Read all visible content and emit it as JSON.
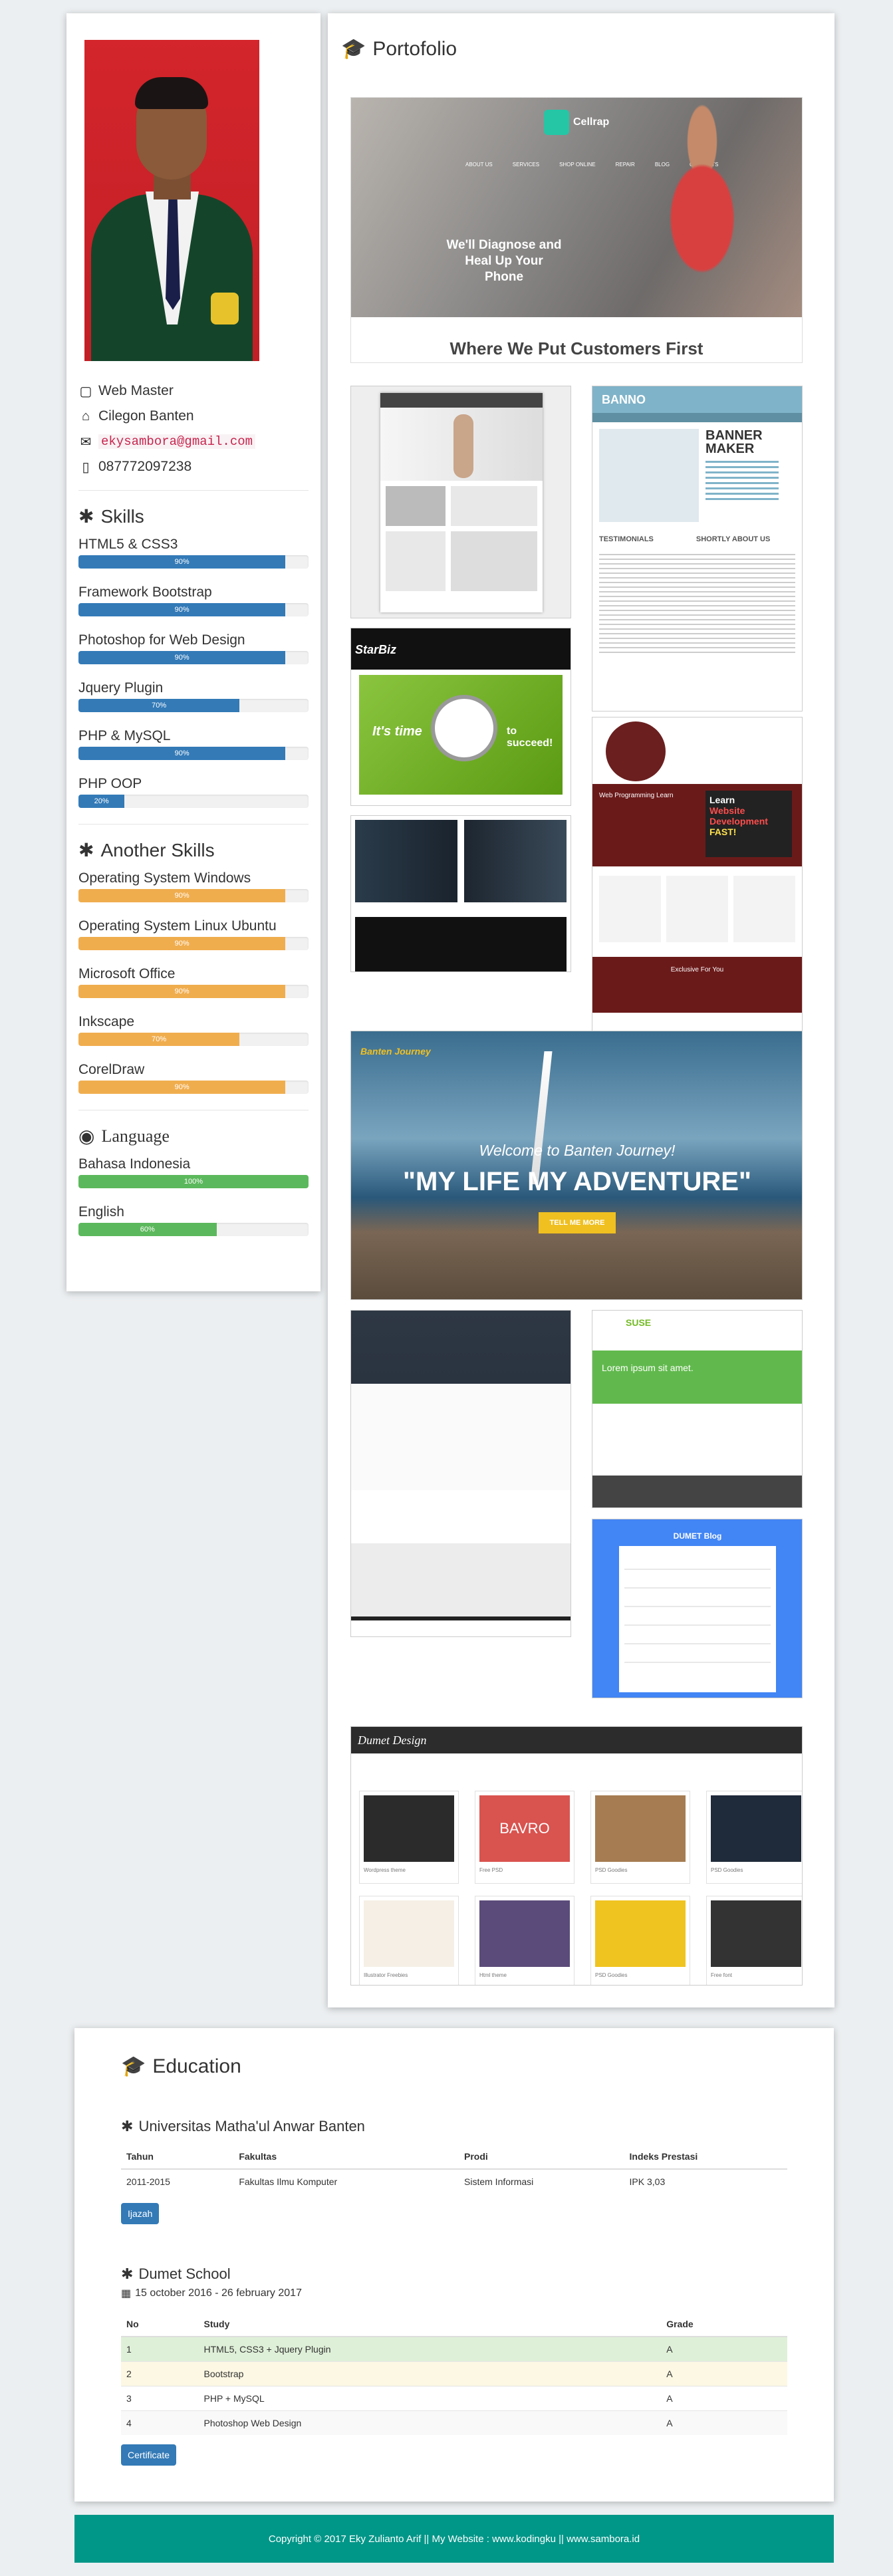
{
  "profile": {
    "job": "Web Master",
    "location": "Cilegon Banten",
    "email": "ekysambora@gmail.com",
    "phone": "087772097238"
  },
  "skills": {
    "title": "Skills",
    "items": [
      {
        "name": "HTML5 & CSS3",
        "label": "90%",
        "level": 0.9
      },
      {
        "name": "Framework Bootstrap",
        "label": "90%",
        "level": 0.9
      },
      {
        "name": "Photoshop for Web Design",
        "label": "90%",
        "level": 0.9
      },
      {
        "name": "Jquery Plugin",
        "label": "70%",
        "level": 0.7
      },
      {
        "name": "PHP & MySQL",
        "label": "90%",
        "level": 0.9
      },
      {
        "name": "PHP OOP",
        "label": "20%",
        "level": 0.2
      }
    ]
  },
  "another_skills": {
    "title": "Another Skills",
    "items": [
      {
        "name": "Operating System Windows",
        "label": "90%",
        "level": 0.9
      },
      {
        "name": "Operating System Linux Ubuntu",
        "label": "90%",
        "level": 0.9
      },
      {
        "name": "Microsoft Office",
        "label": "90%",
        "level": 0.9
      },
      {
        "name": "Inkscape",
        "label": "70%",
        "level": 0.7
      },
      {
        "name": "CorelDraw",
        "label": "90%",
        "level": 0.9
      }
    ]
  },
  "language": {
    "title": "Language",
    "items": [
      {
        "name": "Bahasa Indonesia",
        "label": "100%",
        "level": 1.0
      },
      {
        "name": "English",
        "label": "60%",
        "level": 0.6
      }
    ]
  },
  "portfolio": {
    "title": "Portofolio",
    "cellrapp": {
      "brand": "Cellrap",
      "nav": [
        "ABOUT US",
        "SERVICES",
        "SHOP ONLINE",
        "REPAIR",
        "BLOG",
        "CONTACTS"
      ],
      "headline": "We'll Diagnose and Heal Up Your Phone",
      "tagline": "Where We Put Customers First"
    },
    "banno": {
      "brand": "BANNO",
      "heading": "BANNER MAKER",
      "testimonials": "TESTIMONIALS",
      "about": "SHORTLY ABOUT US"
    },
    "starbiz": {
      "brand": "StarBiz",
      "slogan_a": "It's time",
      "slogan_b": "to succeed!"
    },
    "learn": {
      "line1": "Learn",
      "line2": "Website",
      "line3": "Development",
      "line4": "FAST!",
      "title": "Web Programming Learn",
      "exclusive": "Exclusive For You"
    },
    "banten": {
      "brand": "Banten Journey",
      "welcome": "Welcome to Banten Journey!",
      "headline": "\"MY LIFE MY ADVENTURE\"",
      "cta": "TELL ME MORE"
    },
    "suse": {
      "brand": "SUSE",
      "lorem": "Lorem ipsum sit amet."
    },
    "dumet_blog": {
      "title": "DUMET Blog"
    },
    "dumet_design": {
      "brand": "Dumet Design",
      "cards": [
        "Wordpress theme",
        "Free PSD",
        "PSD Goodies",
        "PSD Goodies",
        "Illustrator Freebies",
        "Html theme",
        "PSD Goodies",
        "Free font"
      ],
      "bavro": "BAVRO"
    }
  },
  "education": {
    "title": "Education",
    "university": {
      "name": "Universitas Matha'ul Anwar Banten",
      "headers": [
        "Tahun",
        "Fakultas",
        "Prodi",
        "Indeks Prestasi"
      ],
      "rows": [
        [
          "2011-2015",
          "Fakultas Ilmu Komputer",
          "Sistem Informasi",
          "IPK 3,03"
        ]
      ],
      "button": "Ijazah"
    },
    "dumet": {
      "name": "Dumet School",
      "dates": "15 october 2016 - 26 february 2017",
      "headers": [
        "No",
        "Study",
        "Grade"
      ],
      "rows": [
        [
          "1",
          "HTML5, CSS3 + Jquery Plugin",
          "A"
        ],
        [
          "2",
          "Bootstrap",
          "A"
        ],
        [
          "3",
          "PHP + MySQL",
          "A"
        ],
        [
          "4",
          "Photoshop Web Design",
          "A"
        ]
      ],
      "button": "Certificate"
    }
  },
  "footer": {
    "text": "Copyright © 2017 Eky Zulianto Arif || My Website : www.kodingku || www.sambora.id"
  }
}
